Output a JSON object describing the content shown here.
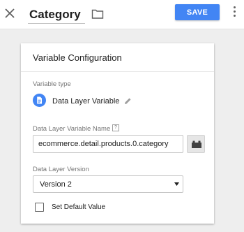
{
  "header": {
    "title": "Category",
    "save_label": "SAVE"
  },
  "card": {
    "title": "Variable Configuration",
    "variable_type_label": "Variable type",
    "variable_type_name": "Data Layer Variable",
    "name_field_label": "Data Layer Variable Name",
    "help_marker": "?",
    "name_field_value": "ecommerce.detail.products.0.category",
    "version_label": "Data Layer Version",
    "version_value": "Version 2",
    "default_value_label": "Set Default Value",
    "default_value_checked": false
  },
  "colors": {
    "accent": "#4285f4",
    "background": "#eeeeee"
  },
  "icons": [
    "close-icon",
    "folder-icon",
    "more-vert-icon",
    "document-icon",
    "pencil-icon",
    "help-icon",
    "lego-brick-icon",
    "dropdown-arrow-icon"
  ]
}
